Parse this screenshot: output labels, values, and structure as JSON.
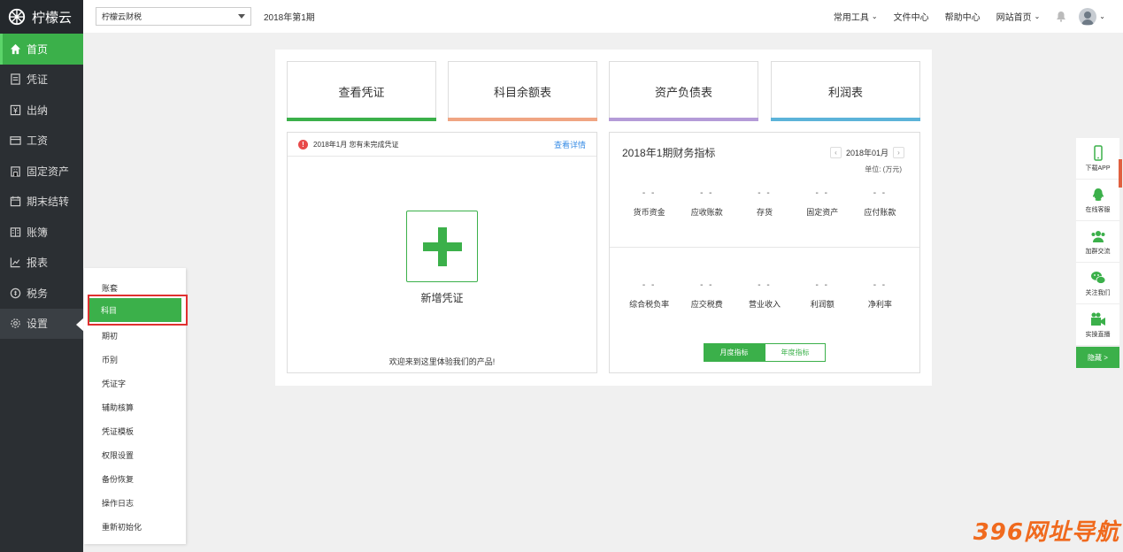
{
  "app": {
    "logo_text": "柠檬云"
  },
  "sidebar": {
    "items": [
      {
        "label": "首页",
        "icon": "home-icon"
      },
      {
        "label": "凭证",
        "icon": "voucher-icon"
      },
      {
        "label": "出纳",
        "icon": "cashier-icon"
      },
      {
        "label": "工资",
        "icon": "salary-icon"
      },
      {
        "label": "固定资产",
        "icon": "asset-icon"
      },
      {
        "label": "期末结转",
        "icon": "calendar-icon"
      },
      {
        "label": "账簿",
        "icon": "ledger-icon"
      },
      {
        "label": "报表",
        "icon": "chart-icon"
      },
      {
        "label": "税务",
        "icon": "tax-icon"
      },
      {
        "label": "设置",
        "icon": "gear-icon"
      }
    ]
  },
  "topbar": {
    "company": "柠檬云财税",
    "period": "2018年第1期",
    "links": [
      "常用工具",
      "文件中心",
      "帮助中心",
      "网站首页"
    ]
  },
  "quick_cards": [
    "查看凭证",
    "科目余额表",
    "资产负债表",
    "利润表"
  ],
  "voucher_box": {
    "notice": "2018年1月 您有未完成凭证",
    "detail_link": "查看详情",
    "add_label": "新增凭证",
    "welcome": "欢迎来到这里体验我们的产品!"
  },
  "finance": {
    "title": "2018年1期财务指标",
    "period": "2018年01月",
    "unit": "单位: (万元)",
    "row1": [
      {
        "value": "- -",
        "label": "货币资金"
      },
      {
        "value": "- -",
        "label": "应收账款"
      },
      {
        "value": "- -",
        "label": "存货"
      },
      {
        "value": "- -",
        "label": "固定资产"
      },
      {
        "value": "- -",
        "label": "应付账款"
      }
    ],
    "row2": [
      {
        "value": "- -",
        "label": "综合税负率"
      },
      {
        "value": "- -",
        "label": "应交税费"
      },
      {
        "value": "- -",
        "label": "营业收入"
      },
      {
        "value": "- -",
        "label": "利润额"
      },
      {
        "value": "- -",
        "label": "净利率"
      }
    ],
    "toggle": {
      "monthly": "月度指标",
      "yearly": "年度指标"
    }
  },
  "settings_menu": [
    "账套",
    "科目",
    "期初",
    "币别",
    "凭证字",
    "辅助核算",
    "凭证模板",
    "权限设置",
    "备份恢复",
    "操作日志",
    "重新初始化"
  ],
  "float_bar": {
    "items": [
      {
        "label": "下载APP",
        "icon": "phone-icon"
      },
      {
        "label": "在线客服",
        "icon": "qq-icon"
      },
      {
        "label": "加群交流",
        "icon": "group-icon"
      },
      {
        "label": "关注我们",
        "icon": "wechat-icon"
      },
      {
        "label": "实操直播",
        "icon": "video-icon"
      }
    ],
    "hide_label": "隐藏 >"
  },
  "watermark": "396网址导航",
  "colors": {
    "accent": "#3bb04a",
    "sidebar": "#2b2f33",
    "highlight": "#e03030"
  }
}
